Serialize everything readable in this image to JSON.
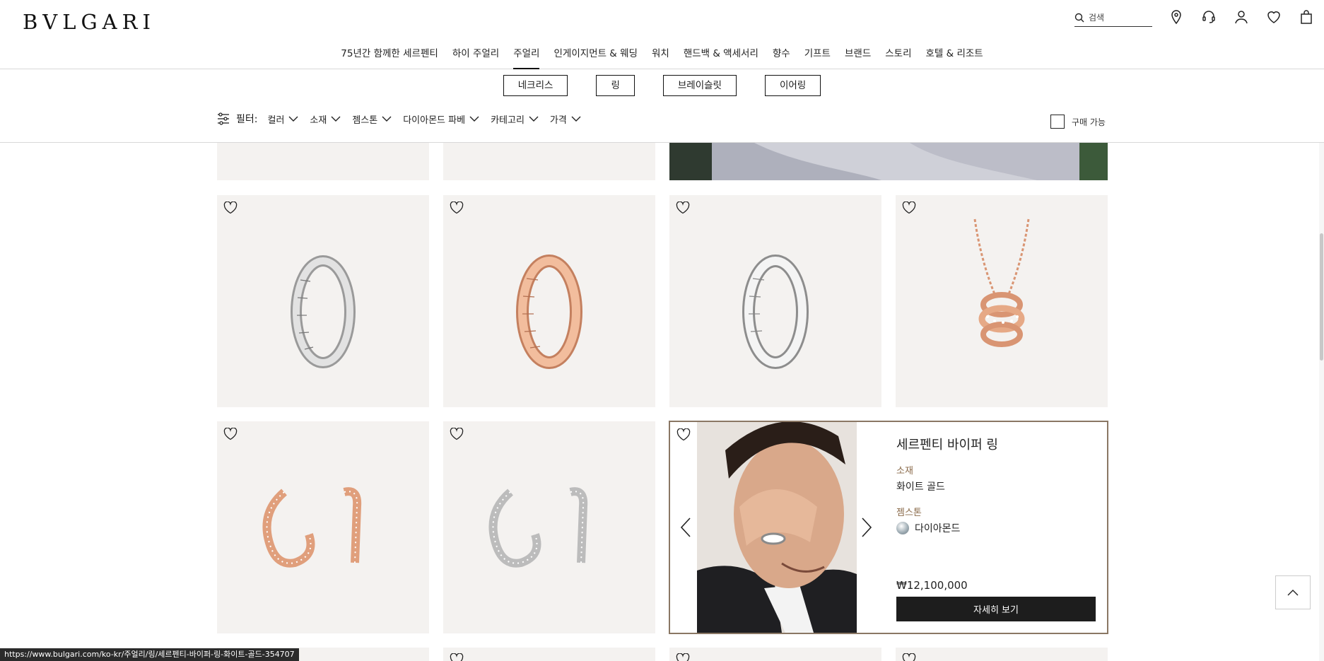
{
  "header": {
    "logo": "BVLGARI",
    "search_placeholder": "검색",
    "nav": [
      "75년간 함께한 세르펜티",
      "하이 주얼리",
      "주얼리",
      "인게이지먼트 & 웨딩",
      "워치",
      "핸드백 & 액세서리",
      "향수",
      "기프트",
      "브랜드",
      "스토리",
      "호텔 & 리조트"
    ],
    "active_nav": "주얼리"
  },
  "subcategories": [
    "네크리스",
    "링",
    "브레이슬릿",
    "이어링"
  ],
  "filters": {
    "label": "필터:",
    "items": [
      "컬러",
      "소재",
      "젬스톤",
      "다이아몬드 파베",
      "카테고리",
      "가격"
    ],
    "available_label": "구매 가능"
  },
  "products": [
    {
      "name": "white-gold-ring",
      "metal": "#c9c9c9"
    },
    {
      "name": "rose-gold-ring",
      "metal": "#e7a987"
    },
    {
      "name": "white-gold-ring-2",
      "metal": "#d2d2d2"
    },
    {
      "name": "rose-gold-pendant",
      "metal": "#e0a07e"
    },
    {
      "name": "rose-gold-earrings",
      "metal": "#e09f7c"
    },
    {
      "name": "white-gold-earrings",
      "metal": "#c6c6c6"
    }
  ],
  "featured": {
    "name": "세르펜티 바이퍼 링",
    "material_label": "소재",
    "material": "화이트 골드",
    "gemstone_label": "젬스톤",
    "gemstone": "다이아몬드",
    "price": "₩12,100,000",
    "cta": "자세히 보기"
  },
  "status_url": "https://www.bulgari.com/ko-kr/주얼리/링/세르펜티-바이퍼-링-화이트-골드-354707",
  "colors": {
    "accent_border": "#8a7764",
    "card_bg": "#f4f2f0",
    "button_bg": "#1d1d1d"
  }
}
